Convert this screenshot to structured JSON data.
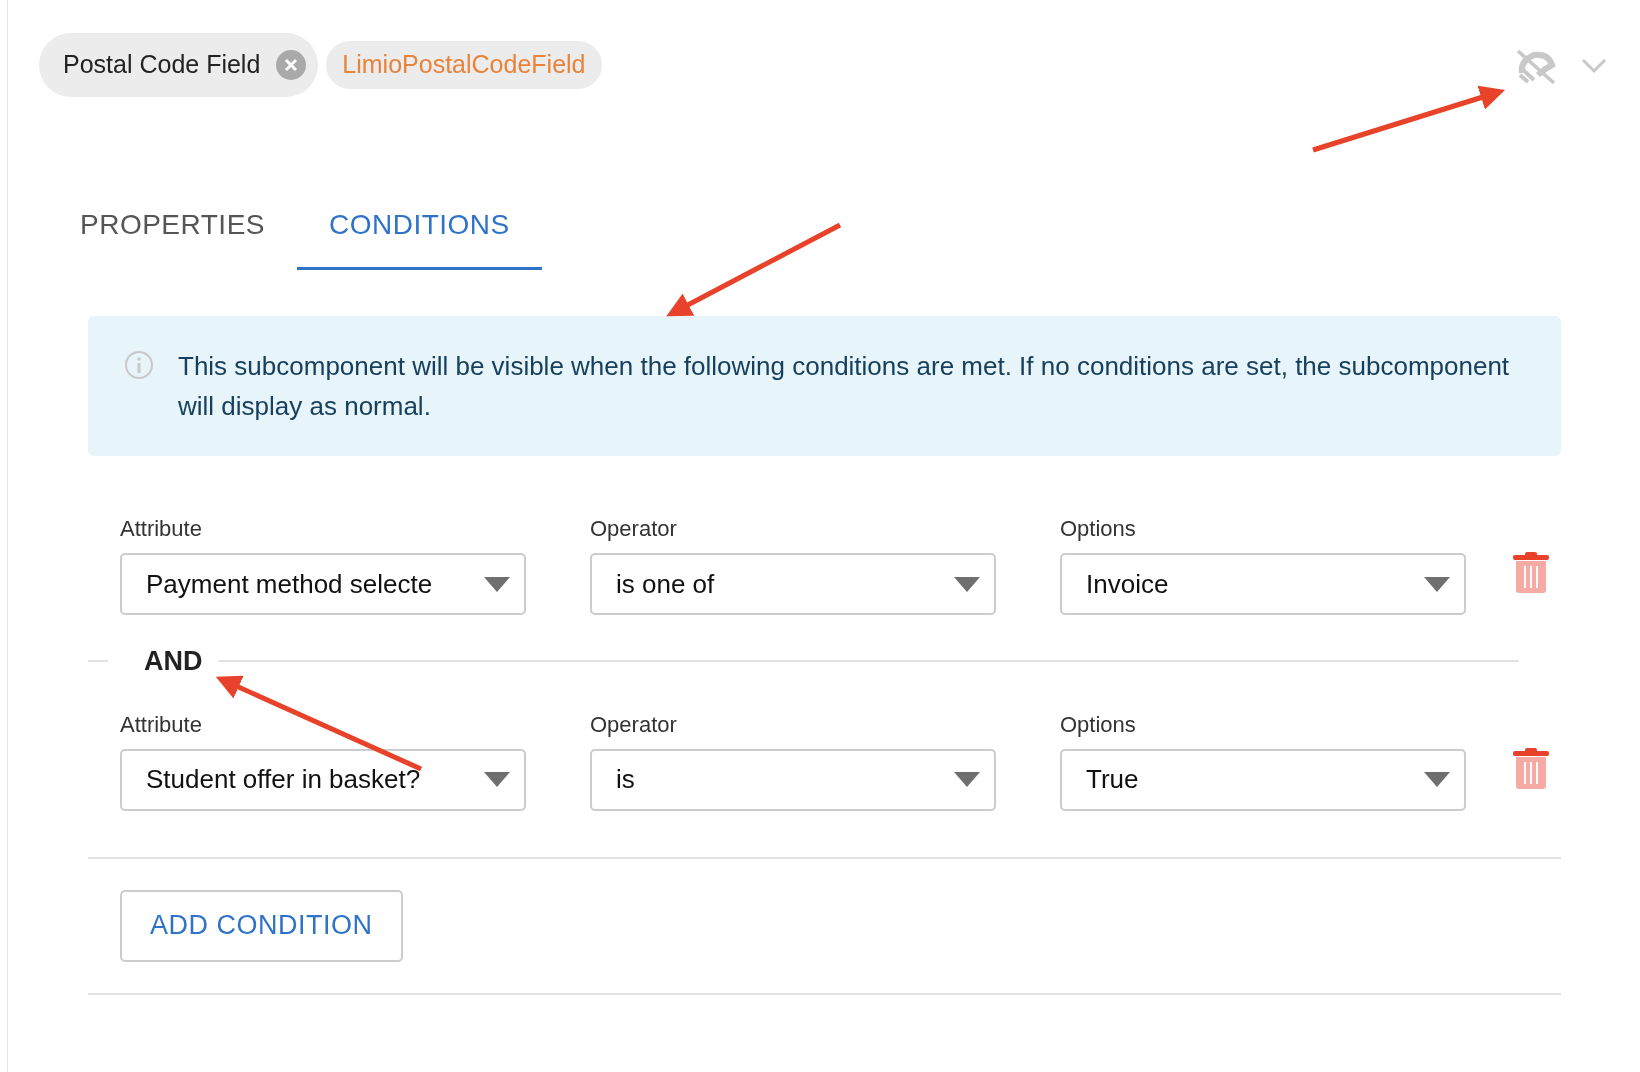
{
  "header": {
    "component_chip": {
      "label": "Postal Code Field"
    },
    "type_chip": {
      "label": "LimioPostalCodeField"
    },
    "visible": false
  },
  "tabs": [
    {
      "label": "PROPERTIES",
      "selected": false
    },
    {
      "label": "CONDITIONS",
      "selected": true
    }
  ],
  "info_alert": {
    "text": "This subcomponent will be visible when the following conditions are met. If no conditions are set, the subcomponent will display as normal."
  },
  "conditions": [
    {
      "attribute_label": "Attribute",
      "attribute": "Payment method selecte",
      "operator_label": "Operator",
      "operator": "is one of",
      "options_label": "Options",
      "options": "Invoice"
    },
    {
      "attribute_label": "Attribute",
      "attribute": "Student offer in basket?",
      "operator_label": "Operator",
      "operator": "is",
      "options_label": "Options",
      "options": "True"
    }
  ],
  "joiner": "AND",
  "add_button": "ADD CONDITION"
}
